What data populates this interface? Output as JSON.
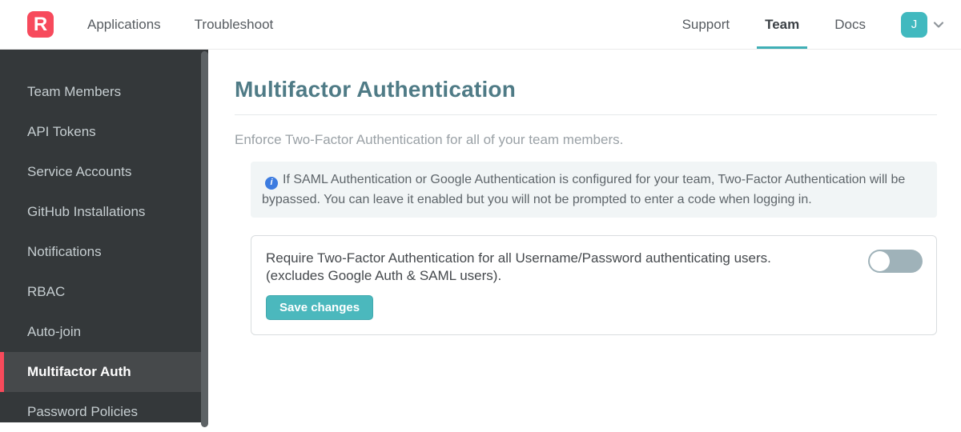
{
  "navbar": {
    "logo_letter": "R",
    "left_items": [
      {
        "label": "Applications"
      },
      {
        "label": "Troubleshoot"
      }
    ],
    "right_items": [
      {
        "label": "Support"
      },
      {
        "label": "Team"
      },
      {
        "label": "Docs"
      }
    ],
    "active_item": "Team",
    "avatar_initial": "J"
  },
  "sidebar": {
    "items": [
      {
        "label": "Team Members"
      },
      {
        "label": "API Tokens"
      },
      {
        "label": "Service Accounts"
      },
      {
        "label": "GitHub Installations"
      },
      {
        "label": "Notifications"
      },
      {
        "label": "RBAC"
      },
      {
        "label": "Auto-join"
      },
      {
        "label": "Multifactor Auth"
      },
      {
        "label": "Password Policies"
      }
    ],
    "active_item": "Multifactor Auth"
  },
  "main": {
    "title": "Multifactor Authentication",
    "description": "Enforce Two-Factor Authentication for all of your team members.",
    "info_note": "If SAML Authentication or Google Authentication is configured for your team, Two-Factor Authentication will be bypassed. You can leave it enabled but you will not be prompted to enter a code when logging in.",
    "setting": {
      "label_line1": "Require Two-Factor Authentication for all Username/Password authenticating users.",
      "label_line2": "(excludes Google Auth & SAML users).",
      "toggle_state": "off",
      "save_label": "Save changes"
    }
  },
  "colors": {
    "brand_red": "#f74a5c",
    "accent_teal": "#41b9bf",
    "title_teal": "#4f7b86",
    "sidebar_bg": "#34383a",
    "active_red_bar": "#f84a5b",
    "info_blue": "#3d7ce0",
    "toggle_off_track": "#9fb2b9",
    "button_teal": "#4bb8bd"
  }
}
